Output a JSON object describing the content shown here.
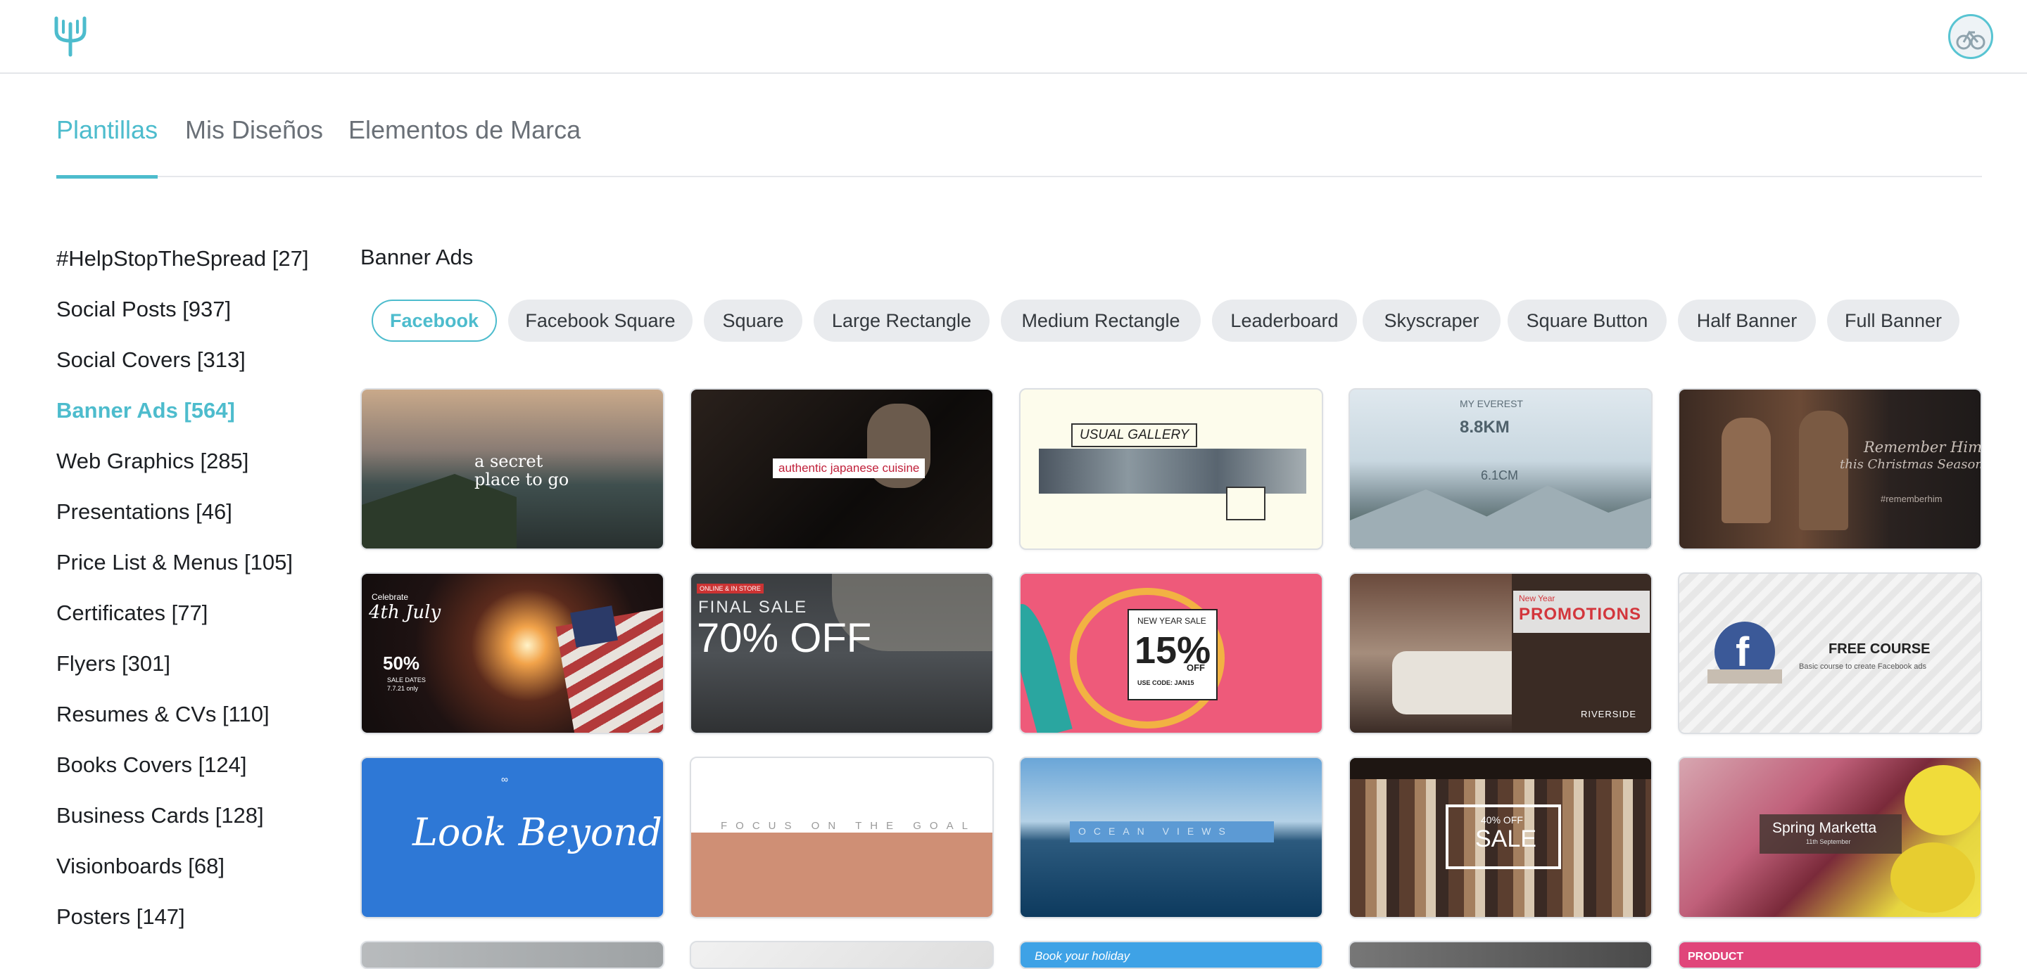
{
  "header": {
    "logo_icon": "brand-logo-icon",
    "avatar_icon": "user-avatar-icon"
  },
  "tabs": [
    {
      "label": "Plantillas",
      "active": true
    },
    {
      "label": "Mis Diseños"
    },
    {
      "label": "Elementos de Marca"
    }
  ],
  "sidebar": {
    "items": [
      {
        "label": "#HelpStopTheSpread [27]"
      },
      {
        "label": "Social Posts [937]"
      },
      {
        "label": "Social Covers [313]"
      },
      {
        "label": "Banner Ads [564]",
        "active": true
      },
      {
        "label": "Web Graphics [285]"
      },
      {
        "label": "Presentations [46]"
      },
      {
        "label": "Price List & Menus [105]"
      },
      {
        "label": "Certificates [77]"
      },
      {
        "label": "Flyers [301]"
      },
      {
        "label": "Resumes & CVs [110]"
      },
      {
        "label": "Books Covers [124]"
      },
      {
        "label": "Business Cards [128]"
      },
      {
        "label": "Visionboards [68]"
      },
      {
        "label": "Posters [147]"
      }
    ]
  },
  "main": {
    "title": "Banner Ads",
    "chips": [
      {
        "label": "Facebook",
        "active": true
      },
      {
        "label": "Facebook Square"
      },
      {
        "label": "Square"
      },
      {
        "label": "Large Rectangle"
      },
      {
        "label": "Medium Rectangle"
      },
      {
        "label": "Leaderboard"
      },
      {
        "label": "Skyscraper"
      },
      {
        "label": "Square Button"
      },
      {
        "label": "Half Banner"
      },
      {
        "label": "Full Banner"
      }
    ],
    "cards": [
      {
        "texts": [
          "a secret",
          "place to go"
        ]
      },
      {
        "texts": [
          "authentic japanese cuisine"
        ]
      },
      {
        "texts": [
          "USUAL GALLERY"
        ]
      },
      {
        "texts": [
          "MY EVEREST",
          "8.8KM",
          "6.1CM"
        ]
      },
      {
        "texts": [
          "Remember Him",
          "this Christmas Season",
          "#rememberhim"
        ]
      },
      {
        "texts": [
          "Celebrate",
          "4th July",
          "50%",
          "SALE DATES",
          "7.7.21 only"
        ]
      },
      {
        "texts": [
          "ONLINE & IN STORE",
          "FINAL SALE",
          "70% OFF"
        ]
      },
      {
        "texts": [
          "NEW YEAR SALE",
          "15%",
          "OFF",
          "USE CODE: JAN15"
        ]
      },
      {
        "texts": [
          "New Year",
          "PROMOTIONS",
          "RIVERSIDE"
        ]
      },
      {
        "texts": [
          "FREE COURSE",
          "Basic course to create Facebook ads"
        ]
      },
      {
        "texts": [
          "Look Beyond"
        ]
      },
      {
        "texts": [
          "FOCUS ON THE GOAL"
        ]
      },
      {
        "texts": [
          "OCEAN VIEWS"
        ]
      },
      {
        "texts": [
          "40% OFF",
          "SALE"
        ]
      },
      {
        "texts": [
          "Spring Marketta",
          "11th September"
        ]
      },
      {
        "texts": []
      },
      {
        "texts": []
      },
      {
        "texts": [
          "Book your holiday"
        ]
      },
      {
        "texts": []
      },
      {
        "texts": [
          "PRODUCT"
        ]
      }
    ]
  },
  "colors": {
    "accent": "#4dbccd",
    "chip_bg": "#e9ebee",
    "divider": "#e4e6e9"
  }
}
